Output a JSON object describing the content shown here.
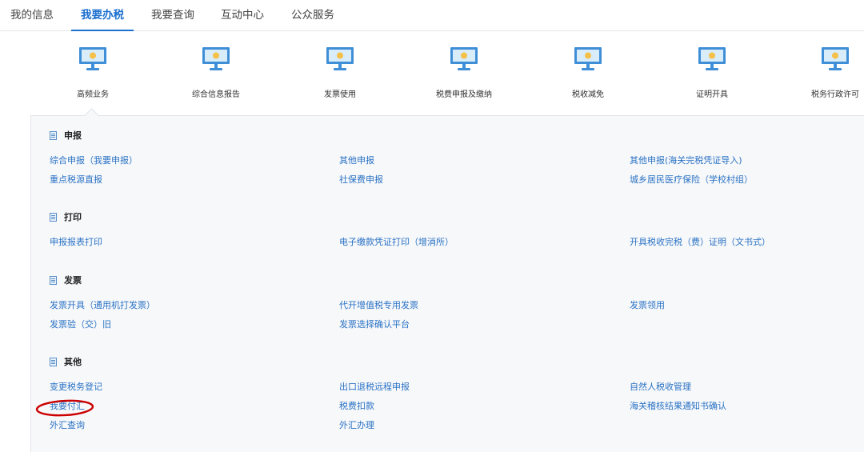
{
  "tabs": [
    "我的信息",
    "我要办税",
    "我要查询",
    "互动中心",
    "公众服务"
  ],
  "icons": [
    "高频业务",
    "综合信息报告",
    "发票使用",
    "税费申报及缴纳",
    "税收减免",
    "证明开具",
    "税务行政许可"
  ],
  "sections": {
    "declare": {
      "title": "申报",
      "links": [
        "综合申报（我要申报）",
        "其他申报",
        "其他申报(海关完税凭证导入)",
        "重点税源直报",
        "社保费申报",
        "城乡居民医疗保险（学校村组）"
      ]
    },
    "print": {
      "title": "打印",
      "links": [
        "申报报表打印",
        "电子缴款凭证打印（增消所）",
        "开具税收完税（费）证明（文书式）"
      ]
    },
    "invoice": {
      "title": "发票",
      "links": [
        "发票开具（通用机打发票）",
        "代开增值税专用发票",
        "发票领用",
        "发票验（交）旧",
        "发票选择确认平台"
      ]
    },
    "other": {
      "title": "其他",
      "links": [
        "变更税务登记",
        "出口退税远程申报",
        "自然人税收管理",
        "我要付汇",
        "税费扣款",
        "海关稽核结果通知书确认",
        "外汇查询",
        "外汇办理"
      ]
    }
  },
  "colors": {
    "accent": "#1a6fcf",
    "link": "#2a72c4",
    "annotation": "#cc0000"
  }
}
